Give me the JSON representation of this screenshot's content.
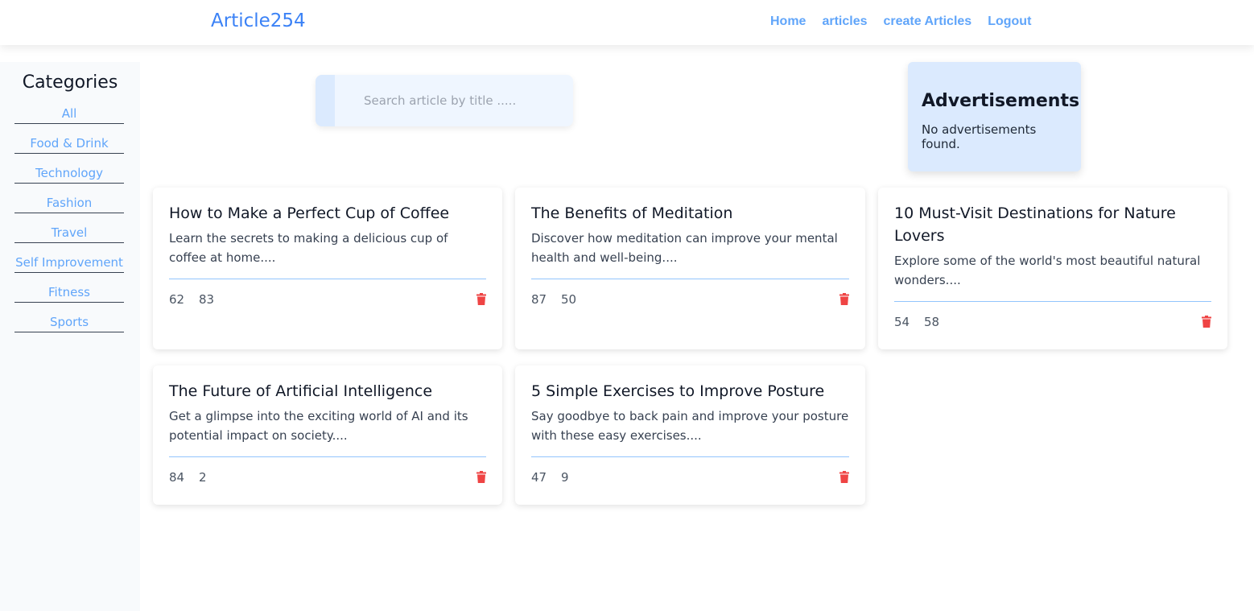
{
  "brand": "Article254",
  "nav": {
    "home": "Home",
    "articles": "articles",
    "create": "create Articles",
    "logout": "Logout"
  },
  "sidebar": {
    "title": "Categories",
    "items": [
      "All",
      "Food & Drink",
      "Technology",
      "Fashion",
      "Travel",
      "Self Improvement",
      "Fitness",
      "Sports"
    ]
  },
  "search": {
    "placeholder": "Search article by title .....",
    "value": ""
  },
  "ads": {
    "title": "Advertisements",
    "empty": "No advertisements found."
  },
  "articles": [
    {
      "title": "How to Make a Perfect Cup of Coffee",
      "description": "Learn the secrets to making a delicious cup of coffee at home....",
      "stat_a": "62",
      "stat_b": "83",
      "icon": "trash-icon"
    },
    {
      "title": "The Benefits of Meditation",
      "description": "Discover how meditation can improve your mental health and well-being....",
      "stat_a": "87",
      "stat_b": "50",
      "icon": "trash-icon"
    },
    {
      "title": "10 Must-Visit Destinations for Nature Lovers",
      "description": "Explore some of the world's most beautiful natural wonders....",
      "stat_a": "54",
      "stat_b": "58",
      "icon": "trash-icon"
    },
    {
      "title": "The Future of Artificial Intelligence",
      "description": "Get a glimpse into the exciting world of AI and its potential impact on society....",
      "stat_a": "84",
      "stat_b": "2",
      "icon": "trash-icon"
    },
    {
      "title": "5 Simple Exercises to Improve Posture",
      "description": "Say goodbye to back pain and improve your posture with these easy exercises....",
      "stat_a": "47",
      "stat_b": "9",
      "icon": "trash-icon"
    }
  ],
  "colors": {
    "accent": "#3b82f6",
    "link": "#60a5fa",
    "delete": "#ef4444",
    "ad_bg": "#dbeafe",
    "sidebar_bg": "#f8fafc"
  }
}
